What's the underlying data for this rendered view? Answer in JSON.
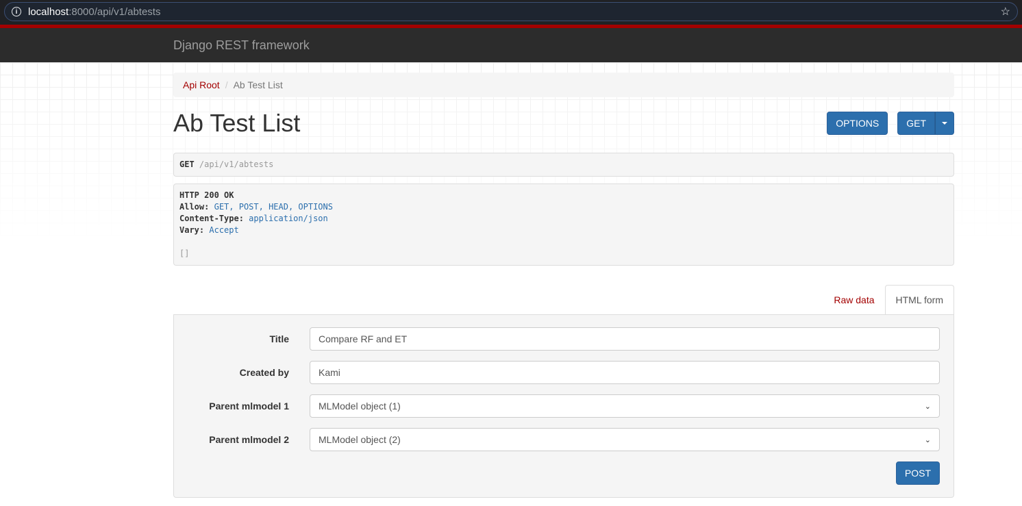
{
  "browser": {
    "url_host": "localhost",
    "url_path": ":8000/api/v1/abtests"
  },
  "navbar": {
    "brand": "Django REST framework"
  },
  "breadcrumb": {
    "root": "Api Root",
    "current": "Ab Test List"
  },
  "page": {
    "title": "Ab Test List",
    "options_label": "OPTIONS",
    "get_label": "GET"
  },
  "request": {
    "method": "GET",
    "path": "/api/v1/abtests"
  },
  "response": {
    "status": "HTTP 200 OK",
    "headers": [
      {
        "key": "Allow:",
        "value": "GET, POST, HEAD, OPTIONS"
      },
      {
        "key": "Content-Type:",
        "value": "application/json"
      },
      {
        "key": "Vary:",
        "value": "Accept"
      }
    ],
    "body": "[]"
  },
  "tabs": {
    "raw": "Raw data",
    "html": "HTML form"
  },
  "form": {
    "fields": [
      {
        "label": "Title",
        "value": "Compare RF and ET"
      },
      {
        "label": "Created by",
        "value": "Kami"
      },
      {
        "label": "Parent mlmodel 1",
        "value": "MLModel object (1)"
      },
      {
        "label": "Parent mlmodel 2",
        "value": "MLModel object (2)"
      }
    ],
    "submit": "POST"
  }
}
